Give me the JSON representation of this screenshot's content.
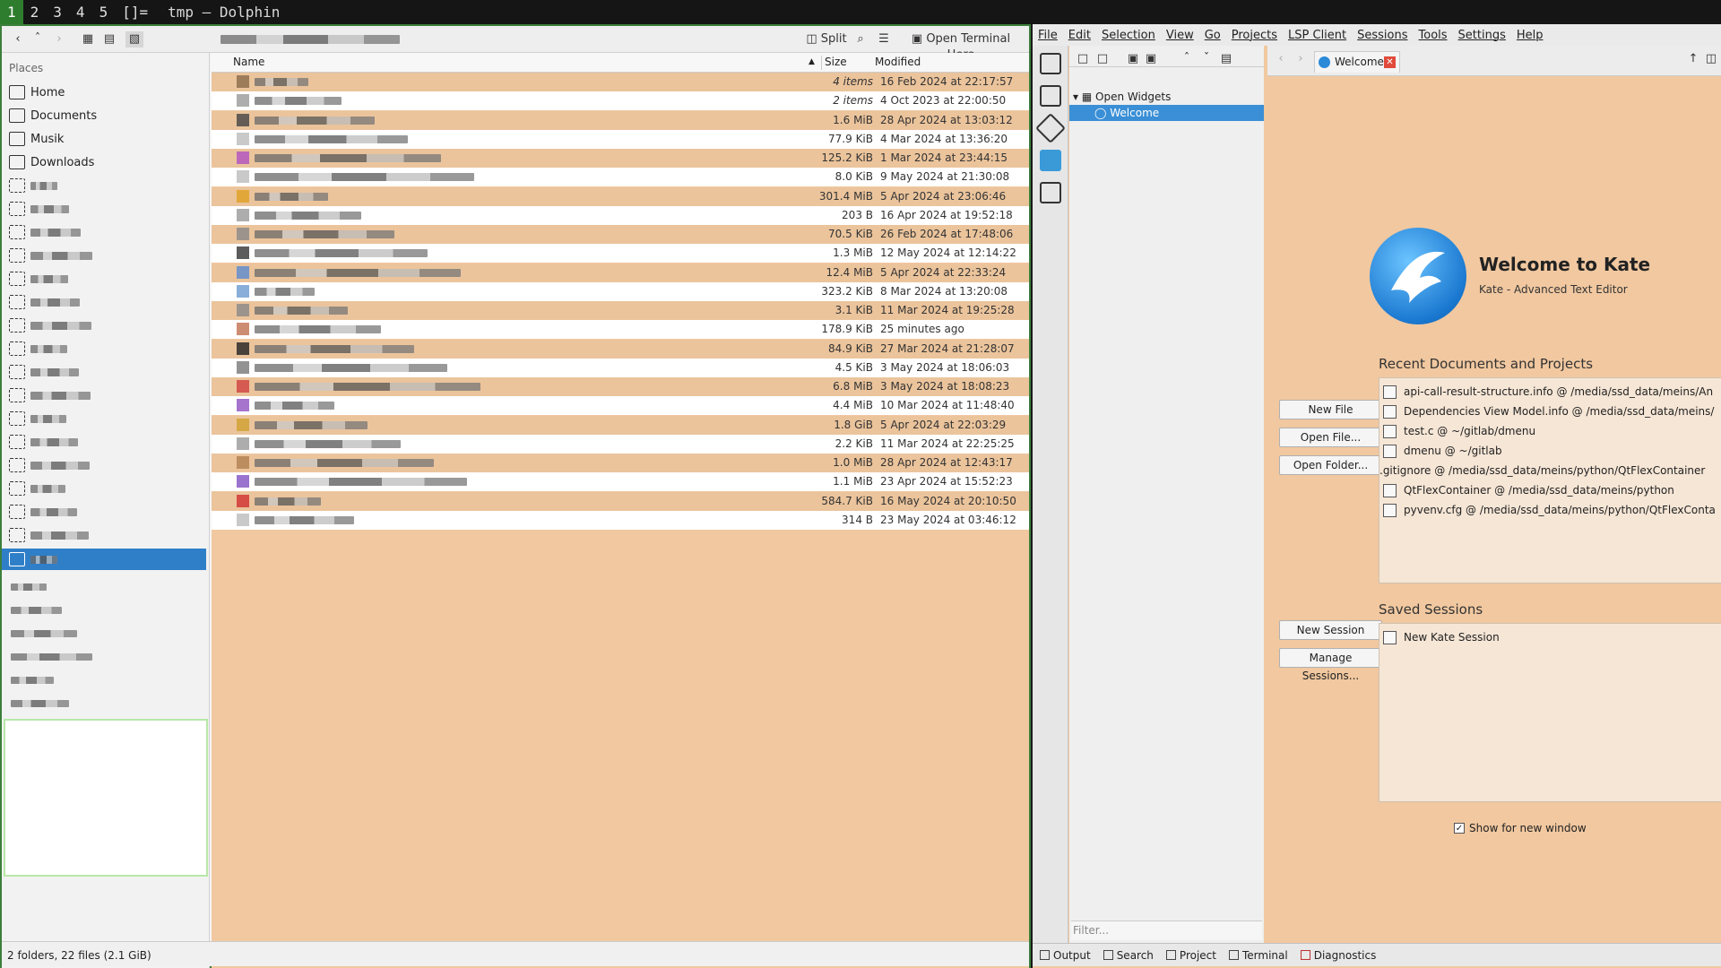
{
  "topbar": {
    "workspaces": [
      "1",
      "2",
      "3",
      "4",
      "5"
    ],
    "layout": "[]=",
    "title": "tmp — Dolphin"
  },
  "dolphin": {
    "toolbar": {
      "split": "Split",
      "terminal": "Open Terminal Here"
    },
    "places": {
      "header": "Places",
      "items": [
        "Home",
        "Documents",
        "Musik",
        "Downloads"
      ]
    },
    "columns": {
      "name": "Name",
      "size": "Size",
      "modified": "Modified"
    },
    "rows": [
      {
        "size": "4 items",
        "modified": "16 Feb 2024 at 22:17:57"
      },
      {
        "size": "2 items",
        "modified": "4 Oct 2023 at 22:00:50"
      },
      {
        "size": "1.6 MiB",
        "modified": "28 Apr 2024 at 13:03:12"
      },
      {
        "size": "77.9 KiB",
        "modified": "4 Mar 2024 at 13:36:20"
      },
      {
        "size": "125.2 KiB",
        "modified": "1 Mar 2024 at 23:44:15"
      },
      {
        "size": "8.0 KiB",
        "modified": "9 May 2024 at 21:30:08"
      },
      {
        "size": "301.4 MiB",
        "modified": "5 Apr 2024 at 23:06:46"
      },
      {
        "size": "203 B",
        "modified": "16 Apr 2024 at 19:52:18"
      },
      {
        "size": "70.5 KiB",
        "modified": "26 Feb 2024 at 17:48:06"
      },
      {
        "size": "1.3 MiB",
        "modified": "12 May 2024 at 12:14:22"
      },
      {
        "size": "12.4 MiB",
        "modified": "5 Apr 2024 at 22:33:24"
      },
      {
        "size": "323.2 KiB",
        "modified": "8 Mar 2024 at 13:20:08"
      },
      {
        "size": "3.1 KiB",
        "modified": "11 Mar 2024 at 19:25:28"
      },
      {
        "size": "178.9 KiB",
        "modified": "25 minutes ago"
      },
      {
        "size": "84.9 KiB",
        "modified": "27 Mar 2024 at 21:28:07"
      },
      {
        "size": "4.5 KiB",
        "modified": "3 May 2024 at 18:06:03"
      },
      {
        "size": "6.8 MiB",
        "modified": "3 May 2024 at 18:08:23"
      },
      {
        "size": "4.4 MiB",
        "modified": "10 Mar 2024 at 11:48:40"
      },
      {
        "size": "1.8 GiB",
        "modified": "5 Apr 2024 at 22:03:29"
      },
      {
        "size": "2.2 KiB",
        "modified": "11 Mar 2024 at 22:25:25"
      },
      {
        "size": "1.0 MiB",
        "modified": "28 Apr 2024 at 12:43:17"
      },
      {
        "size": "1.1 MiB",
        "modified": "23 Apr 2024 at 15:52:23"
      },
      {
        "size": "584.7 KiB",
        "modified": "16 May 2024 at 20:10:50"
      },
      {
        "size": "314 B",
        "modified": "23 May 2024 at 03:46:12"
      }
    ],
    "status": "2 folders, 22 files (2.1 GiB)"
  },
  "kate": {
    "menu": [
      "File",
      "Edit",
      "Selection",
      "View",
      "Go",
      "Projects",
      "LSP Client",
      "Sessions",
      "Tools",
      "Settings",
      "Help"
    ],
    "tree": {
      "root": "Open Widgets",
      "child": "Welcome"
    },
    "filter_placeholder": "Filter...",
    "tab": "Welcome",
    "welcome_title": "Welcome to Kate",
    "welcome_subtitle": "Kate - Advanced Text Editor",
    "buttons": {
      "new_file": "New File",
      "open_file": "Open File...",
      "open_folder": "Open Folder...",
      "new_session": "New Session",
      "manage_sessions": "Manage Sessions..."
    },
    "recent_header": "Recent Documents and Projects",
    "recent": [
      "api-call-result-structure.info @ /media/ssd_data/meins/An",
      "Dependencies View Model.info @ /media/ssd_data/meins/",
      "test.c @ ~/gitlab/dmenu",
      "dmenu @ ~/gitlab",
      ".gitignore @ /media/ssd_data/meins/python/QtFlexContainer",
      "QtFlexContainer @ /media/ssd_data/meins/python",
      "pyvenv.cfg @ /media/ssd_data/meins/python/QtFlexConta"
    ],
    "sessions_header": "Saved Sessions",
    "sessions": [
      "New Kate Session"
    ],
    "show_new_window": "Show for new window",
    "bottom": [
      "Output",
      "Search",
      "Project",
      "Terminal",
      "Diagnostics"
    ]
  }
}
